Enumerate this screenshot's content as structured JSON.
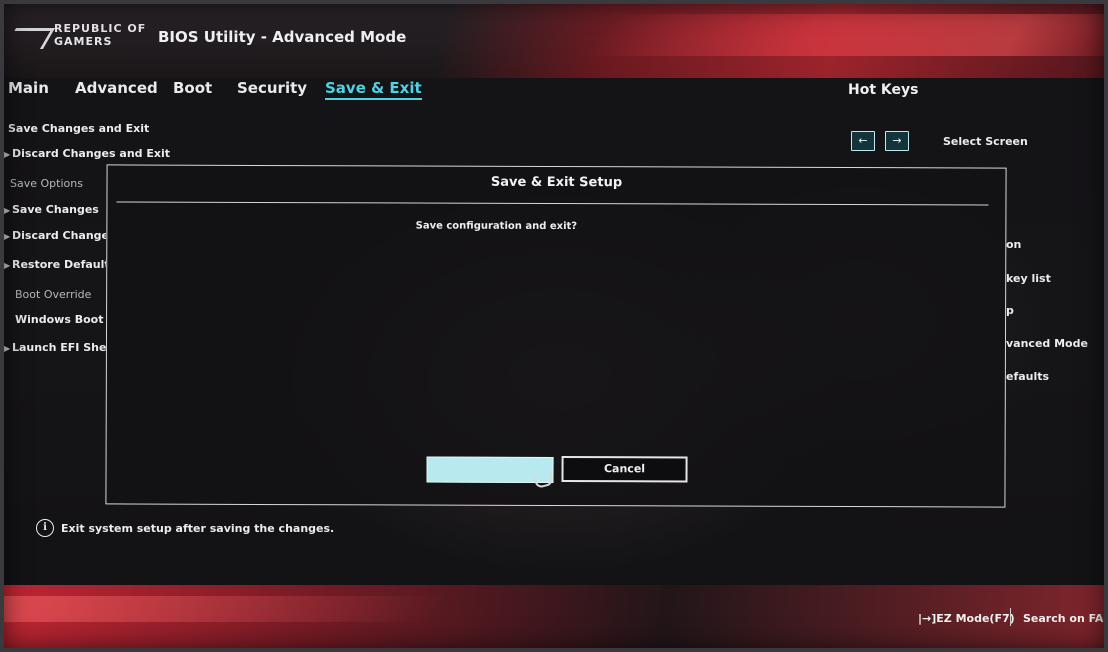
{
  "header": {
    "logo_line1": "REPUBLIC OF",
    "logo_line2": "GAMERS",
    "title": "BIOS Utility - Advanced Mode"
  },
  "tabs": [
    {
      "label": "Main",
      "active": false
    },
    {
      "label": "Advanced",
      "active": false
    },
    {
      "label": "Boot",
      "active": false
    },
    {
      "label": "Security",
      "active": false
    },
    {
      "label": "Save & Exit",
      "active": true
    }
  ],
  "menu": [
    {
      "label": "Save Changes and Exit",
      "type": "item"
    },
    {
      "label": "Discard Changes and Exit",
      "type": "item"
    },
    {
      "label": "Save Options",
      "type": "section"
    },
    {
      "label": "Save Changes",
      "type": "item"
    },
    {
      "label": "Discard Changes",
      "type": "item"
    },
    {
      "label": "Restore Defaults",
      "type": "item"
    },
    {
      "label": "Boot Override",
      "type": "section"
    },
    {
      "label": "Windows Boot Manager",
      "type": "item"
    },
    {
      "label": "Launch EFI Shell",
      "type": "item"
    }
  ],
  "hotkeys": {
    "title": "Hot Keys",
    "left_key": "←",
    "right_key": "→",
    "select_screen": "Select Screen",
    "partial_labels": [
      "on",
      "key list",
      "p",
      "vanced Mode",
      "efaults"
    ]
  },
  "dialog": {
    "title": "Save & Exit Setup",
    "message": "Save configuration and exit?",
    "ok_label": "",
    "cancel_label": "Cancel"
  },
  "help": {
    "icon": "i",
    "text": "Exit system setup after saving the changes."
  },
  "footer": {
    "ez_mode": "|→]EZ Mode(F7)",
    "search": "Search on FAQ"
  },
  "colors": {
    "accent": "#4fd2e3",
    "brand_red": "#d22838",
    "ok_button": "#b8e9ef"
  }
}
